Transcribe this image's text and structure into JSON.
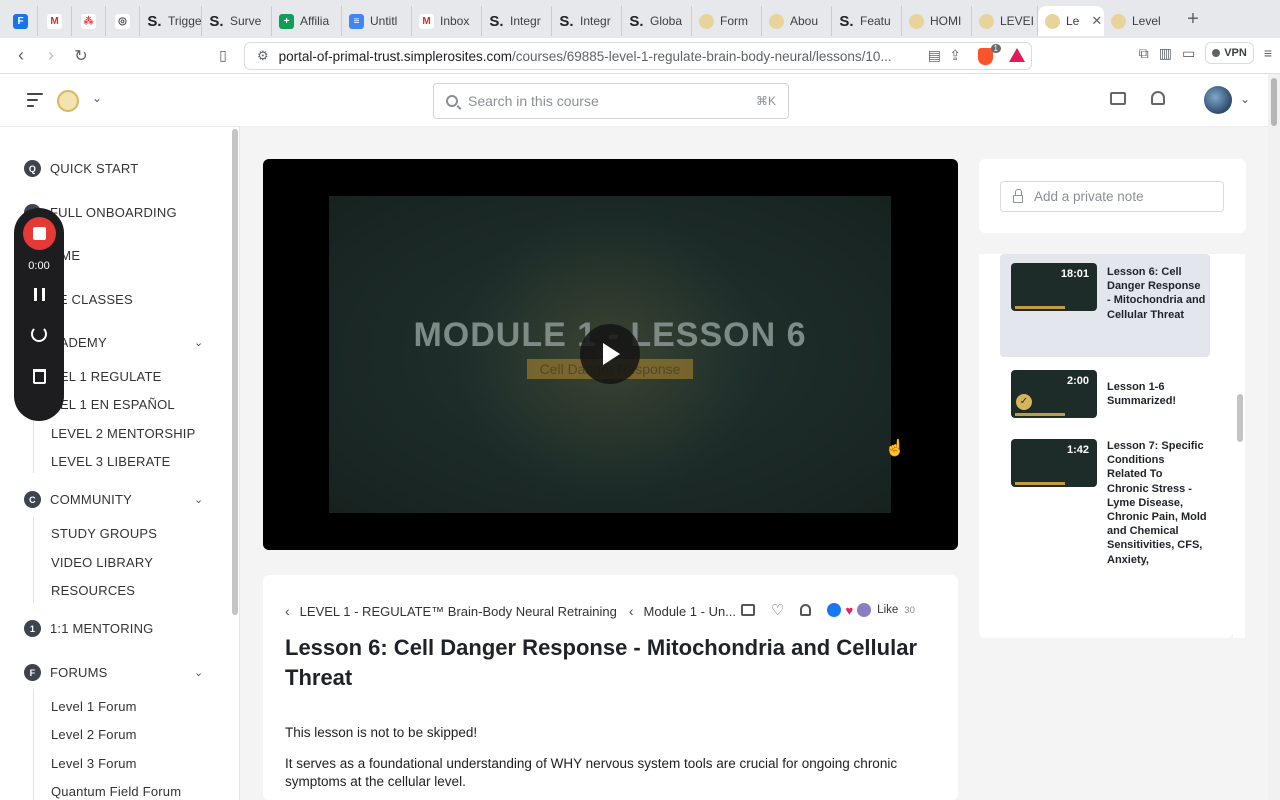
{
  "browser": {
    "tabs": [
      {
        "label": "",
        "fav_color": "#1a73e8",
        "fav_letter": "F"
      },
      {
        "label": "",
        "fav_color": "#ffffff",
        "fav_letter": "M"
      },
      {
        "label": "",
        "fav_color": "#ffffff",
        "fav_letter": "⁂"
      },
      {
        "label": "",
        "fav_color": "#ffffff",
        "fav_letter": "◎"
      },
      {
        "label": "Trigge",
        "fav_color": "#222222",
        "fav_letter": "S"
      },
      {
        "label": "Surve",
        "fav_color": "#222222",
        "fav_letter": "S"
      },
      {
        "label": "Affilia",
        "fav_color": "#0f9d58",
        "fav_letter": "+"
      },
      {
        "label": "Untitl",
        "fav_color": "#4285f4",
        "fav_letter": "≡"
      },
      {
        "label": "Inbox",
        "fav_color": "#ffffff",
        "fav_letter": "M"
      },
      {
        "label": "Integr",
        "fav_color": "#222222",
        "fav_letter": "S"
      },
      {
        "label": "Integr",
        "fav_color": "#222222",
        "fav_letter": "S"
      },
      {
        "label": "Globa",
        "fav_color": "#222222",
        "fav_letter": "S"
      },
      {
        "label": "Form",
        "fav_color": "#e8d39a",
        "fav_letter": ""
      },
      {
        "label": "Abou",
        "fav_color": "#e8d39a",
        "fav_letter": ""
      },
      {
        "label": "Featu",
        "fav_color": "#222222",
        "fav_letter": "S"
      },
      {
        "label": "HOMI",
        "fav_color": "#e8d39a",
        "fav_letter": ""
      },
      {
        "label": "LEVEI",
        "fav_color": "#e8d39a",
        "fav_letter": ""
      },
      {
        "label": "Le",
        "fav_color": "#e8d39a",
        "fav_letter": "",
        "active": true
      },
      {
        "label": "Level",
        "fav_color": "#e8d39a",
        "fav_letter": ""
      }
    ],
    "url_host": "portal-of-primal-trust.simplerosites.com",
    "url_path": "/courses/69885-level-1-regulate-brain-body-neural/lessons/10...",
    "brave_count": "1",
    "vpn_label": "VPN"
  },
  "header": {
    "search_placeholder": "Search in this course",
    "search_shortcut": "⌘K"
  },
  "sidebar": {
    "top_items": [
      {
        "badge": "Q",
        "label": "QUICK START"
      },
      {
        "badge": "",
        "label": "FULL ONBOARDING"
      },
      {
        "badge": "",
        "label": "OME"
      },
      {
        "badge": "",
        "label": "VE CLASSES"
      },
      {
        "badge": "",
        "label": "CADEMY"
      },
      {
        "badge": "C",
        "label": "COMMUNITY"
      },
      {
        "badge": "1",
        "label": "1:1 MENTORING"
      },
      {
        "badge": "F",
        "label": "FORUMS"
      }
    ],
    "academy_items": [
      "VEL 1 REGULATE",
      "VEL 1 EN ESPAÑOL",
      "LEVEL 2 MENTORSHIP",
      "LEVEL 3 LIBERATE"
    ],
    "community_items": [
      "STUDY GROUPS",
      "VIDEO LIBRARY",
      "RESOURCES"
    ],
    "forum_items": [
      "Level 1 Forum",
      "Level 2 Forum",
      "Level 3 Forum",
      "Quantum Field Forum"
    ]
  },
  "recorder": {
    "time": "0:00"
  },
  "video": {
    "title": "MODULE 1 - LESSON 6",
    "subtitle": "Cell Danger Response"
  },
  "lesson": {
    "crumb_course": "LEVEL 1 - REGULATE™ Brain-Body Neural Retraining",
    "crumb_module": "Module 1 - Un...",
    "like_label": "Like",
    "like_count": "30",
    "title": "Lesson 6: Cell Danger Response - Mitochondria and Cellular Threat",
    "para1": "This lesson is not to be skipped!",
    "para2": "It serves as a foundational understanding of WHY nervous system tools are crucial for ongoing chronic symptoms at the cellular level."
  },
  "notes": {
    "placeholder": "Add a private note"
  },
  "lesson_list": [
    {
      "duration": "18:01",
      "title": "Lesson 6: Cell Danger Response - Mitochondria and Cellular Threat",
      "active": true,
      "completed": false
    },
    {
      "duration": "2:00",
      "title": "Lesson 1-6 Summarized!",
      "active": false,
      "completed": true
    },
    {
      "duration": "1:42",
      "title": "Lesson 7: Specific Conditions Related To Chronic Stress - Lyme Disease, Chronic Pain, Mold and Chemical Sensitivities, CFS, Anxiety,",
      "active": false,
      "completed": false
    }
  ]
}
